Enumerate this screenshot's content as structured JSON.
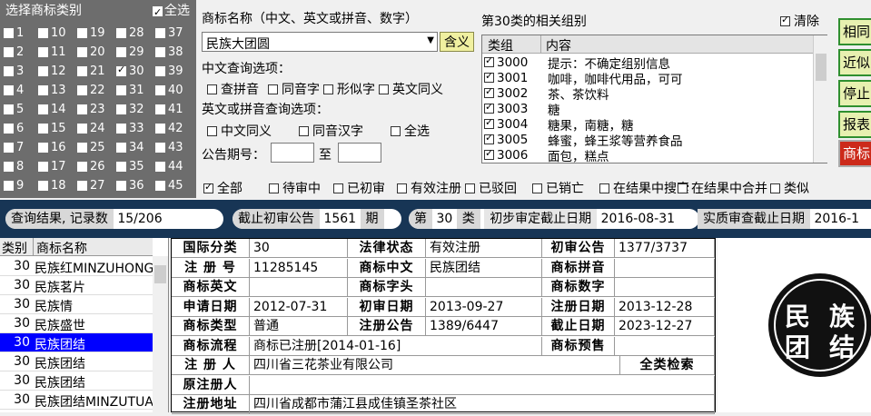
{
  "category_panel": {
    "title": "选择商标类别",
    "select_all": "全选",
    "items": [
      {
        "n": "1",
        "c": false
      },
      {
        "n": "10",
        "c": false
      },
      {
        "n": "19",
        "c": false
      },
      {
        "n": "28",
        "c": false
      },
      {
        "n": "37",
        "c": false
      },
      {
        "n": "2",
        "c": false
      },
      {
        "n": "11",
        "c": false
      },
      {
        "n": "20",
        "c": false
      },
      {
        "n": "29",
        "c": false
      },
      {
        "n": "38",
        "c": false
      },
      {
        "n": "3",
        "c": false
      },
      {
        "n": "12",
        "c": false
      },
      {
        "n": "21",
        "c": false
      },
      {
        "n": "30",
        "c": true
      },
      {
        "n": "39",
        "c": false
      },
      {
        "n": "4",
        "c": false
      },
      {
        "n": "13",
        "c": false
      },
      {
        "n": "22",
        "c": false
      },
      {
        "n": "31",
        "c": false
      },
      {
        "n": "40",
        "c": false
      },
      {
        "n": "5",
        "c": false
      },
      {
        "n": "14",
        "c": false
      },
      {
        "n": "23",
        "c": false
      },
      {
        "n": "32",
        "c": false
      },
      {
        "n": "41",
        "c": false
      },
      {
        "n": "6",
        "c": false
      },
      {
        "n": "15",
        "c": false
      },
      {
        "n": "24",
        "c": false
      },
      {
        "n": "33",
        "c": false
      },
      {
        "n": "42",
        "c": false
      },
      {
        "n": "7",
        "c": false
      },
      {
        "n": "16",
        "c": false
      },
      {
        "n": "25",
        "c": false
      },
      {
        "n": "34",
        "c": false
      },
      {
        "n": "43",
        "c": false
      },
      {
        "n": "8",
        "c": false
      },
      {
        "n": "17",
        "c": false
      },
      {
        "n": "26",
        "c": false
      },
      {
        "n": "35",
        "c": false
      },
      {
        "n": "44",
        "c": false
      },
      {
        "n": "9",
        "c": false
      },
      {
        "n": "18",
        "c": false
      },
      {
        "n": "27",
        "c": false
      },
      {
        "n": "36",
        "c": false
      },
      {
        "n": "45",
        "c": false
      }
    ]
  },
  "search": {
    "name_label": "商标名称（中文、英文或拼音、数字）",
    "name_value": "民族大团圆",
    "meaning_button": "含义",
    "cn_options_label": "中文查询选项：",
    "cn_options": [
      "查拼音",
      "同音字",
      "形似字",
      "英文同义"
    ],
    "en_options_label": "英文或拼音查询选项：",
    "en_options": [
      "中文同义",
      "同音汉字",
      "全选"
    ],
    "issue_label": "公告期号：",
    "issue_to": "至"
  },
  "groups": {
    "title": "第30类的相关组别",
    "clear": "清除",
    "col_group": "类组",
    "col_content": "内容",
    "rows": [
      {
        "code": "3000",
        "text": "提示：不确定组别信息"
      },
      {
        "code": "3001",
        "text": "咖啡，咖啡代用品，可可"
      },
      {
        "code": "3002",
        "text": "茶、茶饮料"
      },
      {
        "code": "3003",
        "text": "糖"
      },
      {
        "code": "3004",
        "text": "糖果，南糖，糖"
      },
      {
        "code": "3005",
        "text": "蜂蜜，蜂王浆等营养食品"
      },
      {
        "code": "3006",
        "text": "面包，糕点"
      }
    ]
  },
  "right_buttons": [
    "相同",
    "近似",
    "停止",
    "报表",
    "商标"
  ],
  "filters": [
    "全部",
    "待审中",
    "已初审",
    "有效注册",
    "已驳回",
    "已销亡",
    "在结果中搜索",
    "在结果中合并",
    "类似"
  ],
  "status": {
    "result_label": "查询结果, 记录数",
    "result_value": "15/206",
    "cutoff_label": "截止初审公告",
    "cutoff_value": "1561",
    "cutoff_unit": "期",
    "class_prefix": "第",
    "class_value": "30",
    "class_suffix": "类",
    "prelim_label": "初步审定截止日期",
    "prelim_value": "2016-08-31",
    "subst_label": "实质审查截止日期",
    "subst_value": "2016-1"
  },
  "list": {
    "col_class": "类别",
    "col_name": "商标名称",
    "rows": [
      {
        "n": "30",
        "t": "民族红MINZUHONG",
        "sel": false
      },
      {
        "n": "30",
        "t": "民族茗片",
        "sel": false
      },
      {
        "n": "30",
        "t": "民族情",
        "sel": false
      },
      {
        "n": "30",
        "t": "民族盛世",
        "sel": false
      },
      {
        "n": "30",
        "t": "民族团结",
        "sel": true
      },
      {
        "n": "30",
        "t": "民族团结",
        "sel": false
      },
      {
        "n": "30",
        "t": "民族团结",
        "sel": false
      },
      {
        "n": "30",
        "t": "民族团结MINZUTUAN",
        "sel": false
      }
    ]
  },
  "detail": {
    "intl_class_k": "国际分类",
    "intl_class_v": "30",
    "legal_k": "法律状态",
    "legal_v": "有效注册",
    "first_pub_k": "初审公告",
    "first_pub_v": "1377/3737",
    "reg_no_k": "注 册 号",
    "reg_no_v": "11285145",
    "cn_k": "商标中文",
    "cn_v": "民族团结",
    "pinyin_k": "商标拼音",
    "pinyin_v": "",
    "en_k": "商标英文",
    "en_v": "",
    "head_k": "商标字头",
    "head_v": "",
    "num_k": "商标数字",
    "num_v": "",
    "apply_k": "申请日期",
    "apply_v": "2012-07-31",
    "first_date_k": "初审日期",
    "first_date_v": "2013-09-27",
    "reg_date_k": "注册日期",
    "reg_date_v": "2013-12-28",
    "type_k": "商标类型",
    "type_v": "普通",
    "reg_pub_k": "注册公告",
    "reg_pub_v": "1389/6447",
    "end_k": "截止日期",
    "end_v": "2023-12-27",
    "flow_k": "商标流程",
    "flow_v": "商标已注册[2014-01-16]",
    "warn_k": "商标预售",
    "warn_v": "",
    "registrant_k": "注 册 人",
    "registrant_v": "四川省三花茶业有限公司",
    "all_search": "全类检索",
    "orig_k": "原注册人",
    "orig_v": "",
    "addr_k": "注册地址",
    "addr_v": "四川省成都市蒲江县成佳镇圣茶社区"
  },
  "logo": {
    "chars": [
      "民",
      "族",
      "团",
      "结"
    ]
  }
}
